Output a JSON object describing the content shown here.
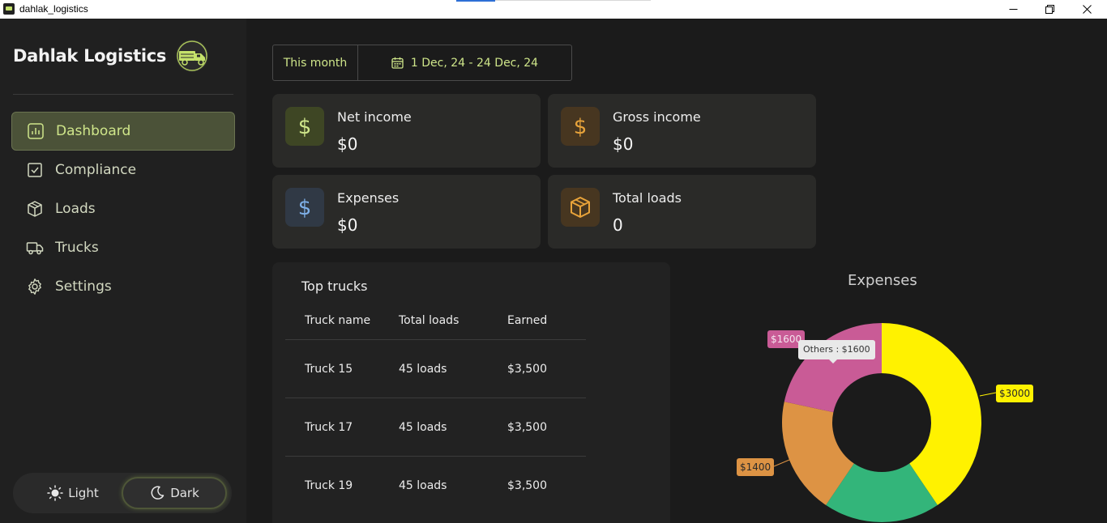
{
  "window": {
    "title": "dahlak_logistics"
  },
  "brand": {
    "name": "Dahlak Logistics"
  },
  "nav": [
    {
      "label": "Dashboard",
      "icon": "chart-icon",
      "active": true
    },
    {
      "label": "Compliance",
      "icon": "checkbox-icon",
      "active": false
    },
    {
      "label": "Loads",
      "icon": "box-icon",
      "active": false
    },
    {
      "label": "Trucks",
      "icon": "truck-icon",
      "active": false
    },
    {
      "label": "Settings",
      "icon": "gear-icon",
      "active": false
    }
  ],
  "theme": {
    "light_label": "Light",
    "dark_label": "Dark",
    "selected": "Dark"
  },
  "date_filter": {
    "period": "This month",
    "range": "1 Dec, 24 - 24 Dec, 24"
  },
  "cards": {
    "net_income": {
      "label": "Net income",
      "value": "$0",
      "icon": "dollar-icon",
      "color": "#cfe68a"
    },
    "gross_income": {
      "label": "Gross income",
      "value": "$0",
      "icon": "dollar-icon",
      "color": "#e8a33a"
    },
    "expenses": {
      "label": "Expenses",
      "value": "$0",
      "icon": "dollar-icon",
      "color": "#7fb0e8"
    },
    "total_loads": {
      "label": "Total loads",
      "value": "0",
      "icon": "package-icon",
      "color": "#e8a33a"
    }
  },
  "top_trucks": {
    "title": "Top trucks",
    "columns": [
      "Truck name",
      "Total loads",
      "Earned"
    ],
    "rows": [
      [
        "Truck 15",
        "45 loads",
        "$3,500"
      ],
      [
        "Truck 17",
        "45 loads",
        "$3,500"
      ],
      [
        "Truck 19",
        "45 loads",
        "$3,500"
      ]
    ]
  },
  "chart_data": {
    "type": "pie",
    "title": "Expenses",
    "donut": true,
    "categories": [
      "",
      "",
      "",
      "Others"
    ],
    "values": [
      3000,
      1400,
      1400,
      1600
    ],
    "labels": [
      "$3000",
      "",
      "$1400",
      "$1600"
    ],
    "colors": [
      "#fff200",
      "#33b57a",
      "#dd9344",
      "#c95b96"
    ],
    "tooltip": "Others : $1600"
  }
}
